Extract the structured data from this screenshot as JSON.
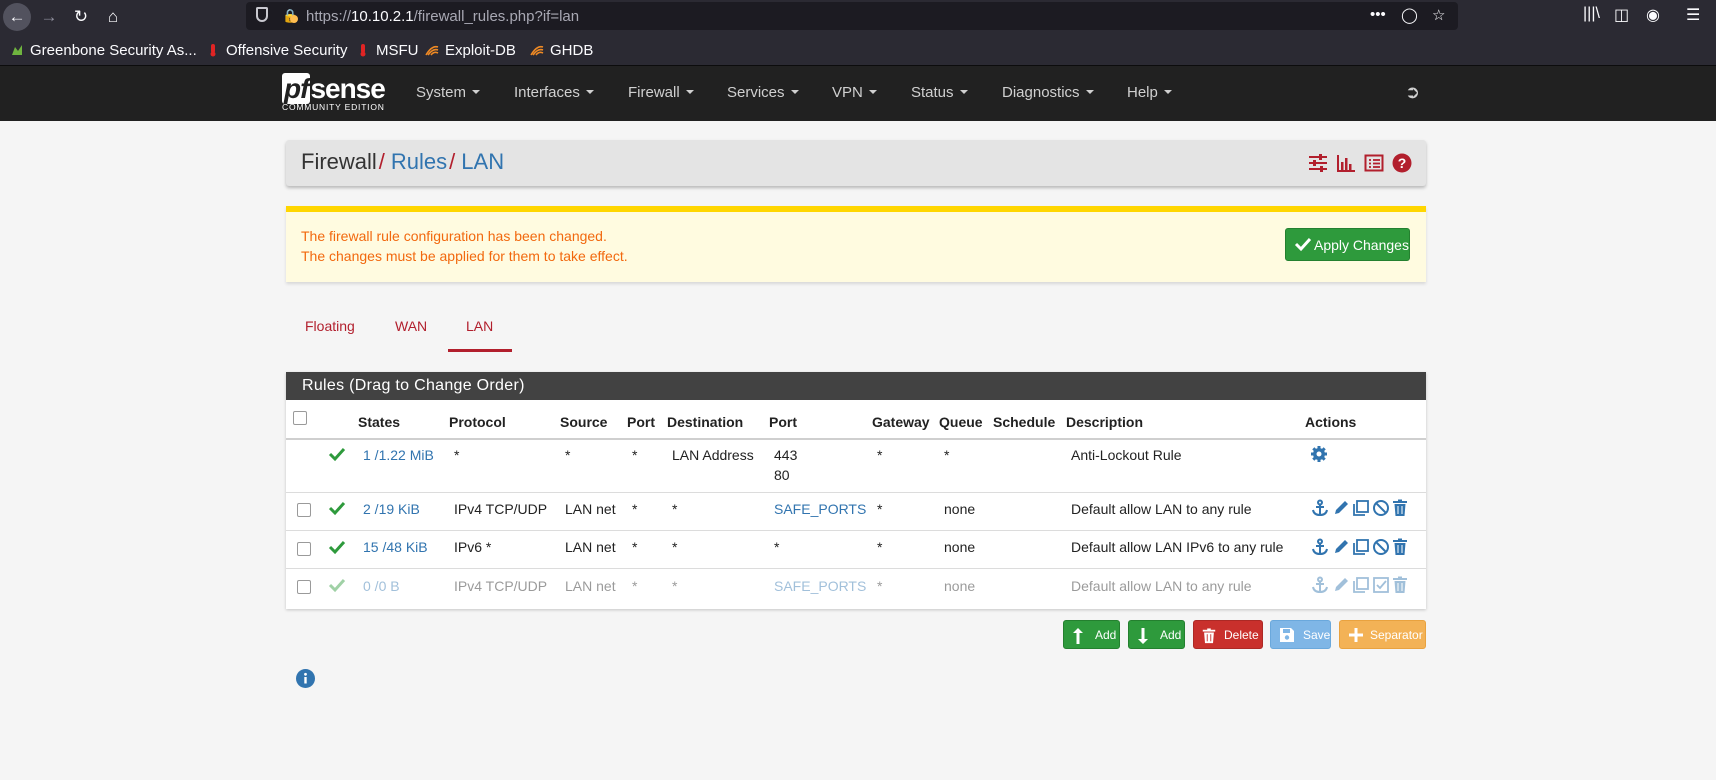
{
  "browser": {
    "url_host": "10.10.2.1",
    "url_path": "/firewall_rules.php?if=lan",
    "url_scheme": "https://",
    "bookmarks": [
      {
        "label": "Greenbone Security As...",
        "icon": "greenbone-icon",
        "color": "#6fb43f"
      },
      {
        "label": "Offensive Security",
        "icon": "offsec-icon",
        "color": "#e02424"
      },
      {
        "label": "MSFU",
        "icon": "msfu-icon",
        "color": "#e02424"
      },
      {
        "label": "Exploit-DB",
        "icon": "exploitdb-icon",
        "color": "#f08a24"
      },
      {
        "label": "GHDB",
        "icon": "ghdb-icon",
        "color": "#f08a24"
      }
    ]
  },
  "navbar": {
    "logo_main": "sense",
    "logo_pf": "pf",
    "logo_sub": "COMMUNITY EDITION",
    "menus": [
      "System",
      "Interfaces",
      "Firewall",
      "Services",
      "VPN",
      "Status",
      "Diagnostics",
      "Help"
    ]
  },
  "breadcrumb": {
    "root": "Firewall",
    "sep": "/",
    "level2": "Rules",
    "level3": "LAN"
  },
  "alert": {
    "line1": "The firewall rule configuration has been changed.",
    "line2": "The changes must be applied for them to take effect.",
    "apply_label": "Apply Changes"
  },
  "tabs": [
    "Floating",
    "WAN",
    "LAN"
  ],
  "active_tab": "LAN",
  "table": {
    "title": "Rules (Drag to Change Order)",
    "headers": [
      "States",
      "Protocol",
      "Source",
      "Port",
      "Destination",
      "Port",
      "Gateway",
      "Queue",
      "Schedule",
      "Description",
      "Actions"
    ],
    "rows": [
      {
        "states": "1 /1.22 MiB",
        "protocol": "*",
        "source": "*",
        "sport": "*",
        "destination": "LAN Address",
        "dport": "443",
        "dport2": "80",
        "gateway": "*",
        "queue": "*",
        "schedule": "",
        "description": "Anti-Lockout Rule"
      },
      {
        "states": "2 /19 KiB",
        "protocol": "IPv4 TCP/UDP",
        "source": "LAN net",
        "sport": "*",
        "destination": "*",
        "dport": "SAFE_PORTS",
        "gateway": "*",
        "queue": "none",
        "schedule": "",
        "description": "Default allow LAN to any rule"
      },
      {
        "states": "15 /48 KiB",
        "protocol": "IPv6 *",
        "source": "LAN net",
        "sport": "*",
        "destination": "*",
        "dport": "*",
        "gateway": "*",
        "queue": "none",
        "schedule": "",
        "description": "Default allow LAN IPv6 to any rule"
      },
      {
        "states": "0 /0 B",
        "protocol": "IPv4 TCP/UDP",
        "source": "LAN net",
        "sport": "*",
        "destination": "*",
        "dport": "SAFE_PORTS",
        "gateway": "*",
        "queue": "none",
        "schedule": "",
        "description": "Default allow LAN to any rule"
      }
    ]
  },
  "buttons": {
    "add_top": "Add",
    "add_bottom": "Add",
    "delete": "Delete",
    "save": "Save",
    "separator": "Separator"
  },
  "colors": {
    "brand_red": "#b21f2d",
    "link_blue": "#3174af",
    "success_green": "#2e9a3c",
    "danger": "#c9302c",
    "info": "#5bc0de",
    "warning": "#f0ad4e"
  }
}
